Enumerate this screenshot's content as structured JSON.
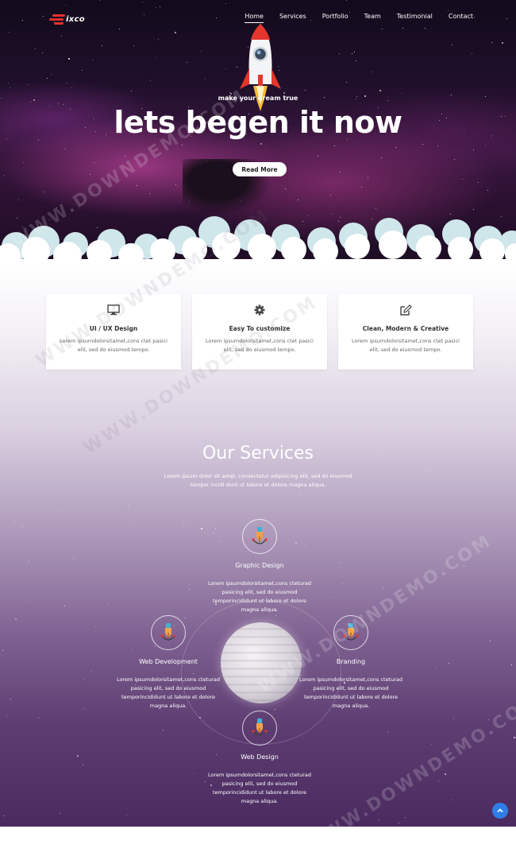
{
  "brand": {
    "name": "ixco",
    "accent": "#e5322d"
  },
  "nav": {
    "items": [
      {
        "label": "Home",
        "active": true
      },
      {
        "label": "Services",
        "active": false
      },
      {
        "label": "Portfolio",
        "active": false
      },
      {
        "label": "Team",
        "active": false
      },
      {
        "label": "Testimonial",
        "active": false
      },
      {
        "label": "Contact",
        "active": false
      }
    ]
  },
  "hero": {
    "subtitle": "make your dream true",
    "title": "lets begen it now",
    "button_label": "Read More"
  },
  "features": [
    {
      "icon": "monitor-icon",
      "title": "UI / UX Design",
      "text": "Lorem ipsumdolorsitamet,cons ctet pasici elit, sed do eiusmod tempo."
    },
    {
      "icon": "gear-icon",
      "title": "Easy To customize",
      "text": "Lorem ipsumdolorsitamet,cons ctet pasici elit, sed do eiusmod tempo."
    },
    {
      "icon": "edit-icon",
      "title": "Clean, Modern & Creative",
      "text": "Lorem ipsumdolorsitamet,cons ctet pasici elit, sed do eiusmod tempo."
    }
  ],
  "services": {
    "heading": "Our Services",
    "intro": "Lorem ipsum dolor sit amet, consectetur adipisicing elit, sed do eiusmod tempor incidi dunt ut labore et dolore magna aliqua.",
    "items": [
      {
        "icon": "pen-tool-icon",
        "title": "Graphic Design",
        "text": "Lorem ipsumdolorsitamet,cons cteturad pasicing elit, sed do eiusmod temporincididunt ut labore et dolore magna aliqua."
      },
      {
        "icon": "pen-tool-icon",
        "title": "Web Development",
        "text": "Lorem ipsumdolorsitamet,cons cteturad pasicing elit, sed do eiusmod temporincididunt ut labore et dolore magna aliqua."
      },
      {
        "icon": "pen-tool-icon",
        "title": "Branding",
        "text": "Lorem ipsumdolorsitamet,cons cteturad pasicing elit, sed do eiusmod temporincididunt ut labore et dolore magna aliqua."
      },
      {
        "icon": "pen-tool-icon",
        "title": "Web Design",
        "text": "Lorem ipsumdolorsitamet,cons cteturad pasicing elit, sed do eiusmod temporincididunt ut labore et dolore magna aliqua."
      }
    ]
  },
  "watermark": "WWW.DOWNDEMO.COM",
  "back_to_top": {
    "icon": "chevron-up-icon",
    "color": "#2f7ee8"
  }
}
